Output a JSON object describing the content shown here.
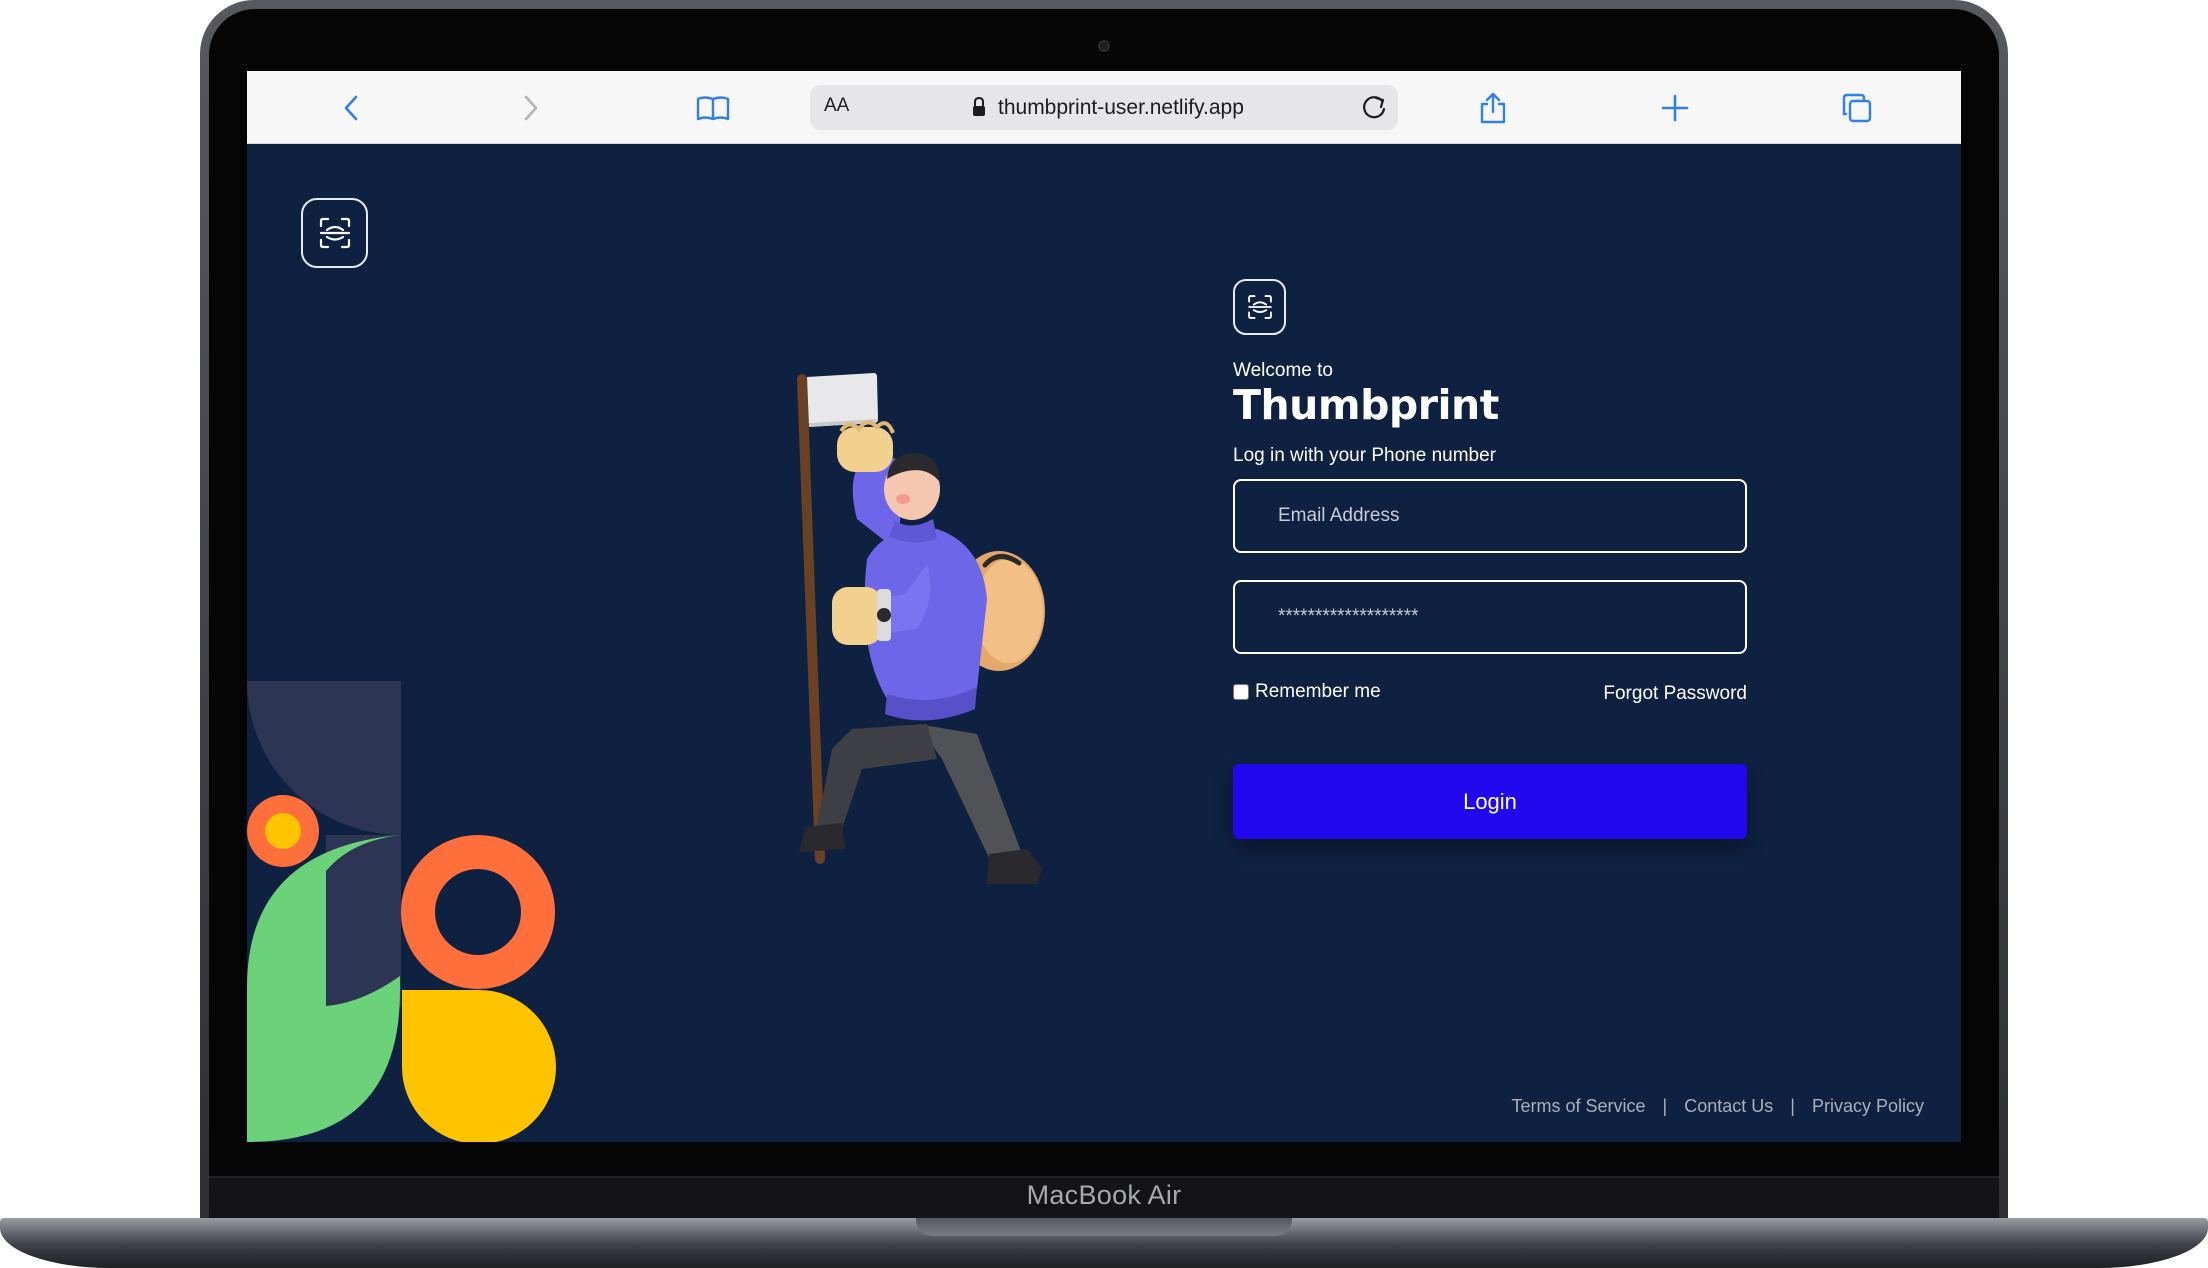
{
  "device": {
    "label": "MacBook Air"
  },
  "browser": {
    "text_size_label": "AA",
    "url": "thumbprint-user.netlify.app",
    "icons": [
      "chevron-left-icon",
      "chevron-right-icon",
      "book-icon",
      "lock-icon",
      "reload-icon",
      "share-icon",
      "plus-icon",
      "tabs-icon"
    ]
  },
  "login": {
    "welcome": "Welcome to",
    "brand": "Thumbprint",
    "subtitle": "Log in with your Phone number",
    "email_placeholder": "Email Address",
    "password_value": "*******************",
    "remember_label": "Remember me",
    "forgot_label": "Forgot Password",
    "submit_label": "Login"
  },
  "footer": {
    "links": [
      "Terms of Service",
      "Contact Us",
      "Privacy Policy"
    ],
    "separator": "|"
  },
  "colors": {
    "background": "#0f2140",
    "accent": "#2007ee",
    "deco_green": "#6bd279",
    "deco_orange": "#ff6f3c",
    "deco_yellow": "#ffc300",
    "deco_navy": "#2c3553"
  }
}
